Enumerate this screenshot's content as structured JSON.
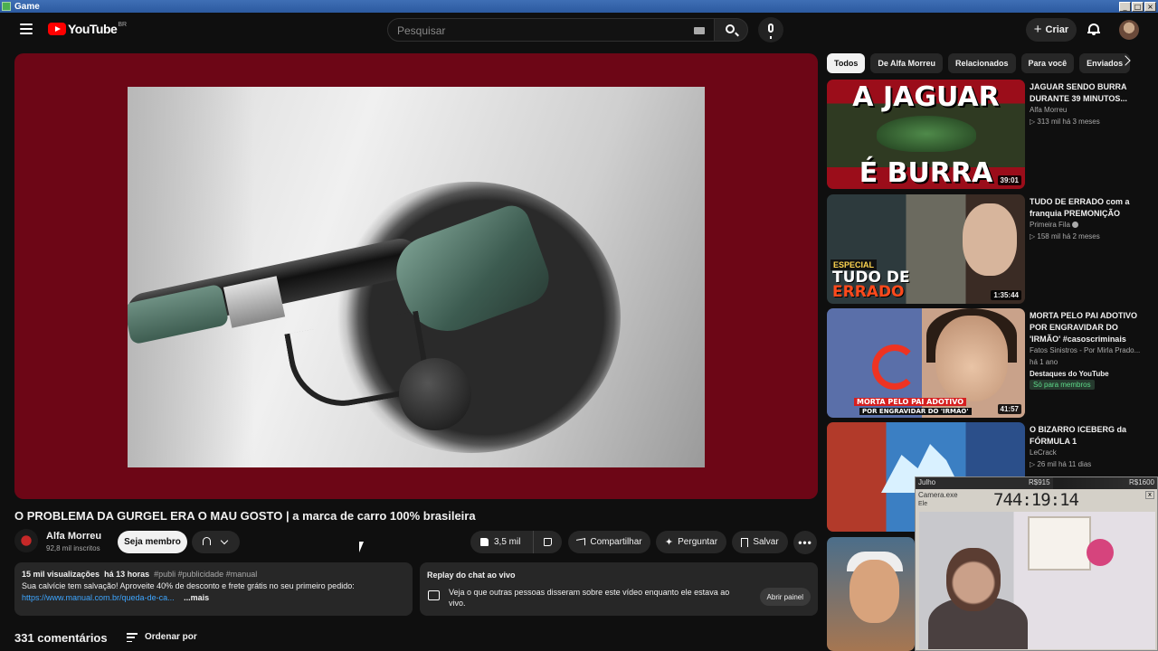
{
  "os_window": {
    "title": "Game"
  },
  "header": {
    "logo_text": "YouTube",
    "logo_region": "BR",
    "search_placeholder": "Pesquisar",
    "create_label": "Criar"
  },
  "video": {
    "title": "O PROBLEMA DA GURGEL ERA O MAU GOSTO | a marca de carro 100% brasileira",
    "channel_name": "Alfa Morreu",
    "subscribers": "92,8 mil inscritos",
    "member_button": "Seja membro",
    "likes": "3,5 mil",
    "share_label": "Compartilhar",
    "ask_label": "Perguntar",
    "save_label": "Salvar",
    "more_label": "•••"
  },
  "description": {
    "views": "15 mil visualizações",
    "time": "há 13 horas",
    "tags": "#publi #publicidade #manual",
    "text": "Sua calvície tem salvação! Aproveite 40% de desconto e frete grátis no seu primeiro pedido:",
    "link": "https://www.manual.com.br/queda-de-ca...",
    "more": "...mais"
  },
  "chat_replay": {
    "title": "Replay do chat ao vivo",
    "text": "Veja o que outras pessoas disseram sobre este vídeo enquanto ele estava ao vivo.",
    "button": "Abrir painel"
  },
  "comments": {
    "count": "331 comentários",
    "sort_label": "Ordenar por"
  },
  "chips": [
    "Todos",
    "De Alfa Morreu",
    "Relacionados",
    "Para você",
    "Enviados"
  ],
  "recommendations": [
    {
      "title": "JAGUAR SENDO BURRA DURANTE 39 MINUTOS...",
      "channel": "Alfa Morreu",
      "meta": "▷ 313 mil  há 3 meses",
      "duration": "39:01",
      "thumb_text_1": "A JAGUAR",
      "thumb_text_2": "É BURRA"
    },
    {
      "title": "TUDO DE ERRADO com a franquia PREMONIÇÃO",
      "channel": "Primeira Fila",
      "meta": "▷ 158 mil  há 2 meses",
      "duration": "1:35:44",
      "thumb_badge": "ESPECIAL",
      "thumb_text_1": "TUDO DE",
      "thumb_text_2": "ERRADO"
    },
    {
      "title": "MORTA PELO PAI ADOTIVO POR ENGRAVIDAR DO 'IRMÃO' #casoscriminais",
      "channel": "Fatos Sinistros - Por Mirla Prado...",
      "meta": "há 1 ano",
      "extra": "Destaques do YouTube",
      "members": "Só para membros",
      "duration": "41:57",
      "thumb_text_1": "MORTA PELO PAI ADOTIVO",
      "thumb_text_2": "POR ENGRAVIDAR DO 'IRMÃO'"
    },
    {
      "title": "O BIZARRO ICEBERG da FÓRMULA 1",
      "channel": "LeCrack",
      "meta": "▷ 26 mil  há 11 dias"
    }
  ],
  "overlay": {
    "month": "Julho",
    "mid_value": "R$915",
    "right_value": "R$1600",
    "progress": 0.57,
    "camera_title": "Camera.exe",
    "menu": "Ele",
    "timer": "744:19:14",
    "close": "x"
  }
}
